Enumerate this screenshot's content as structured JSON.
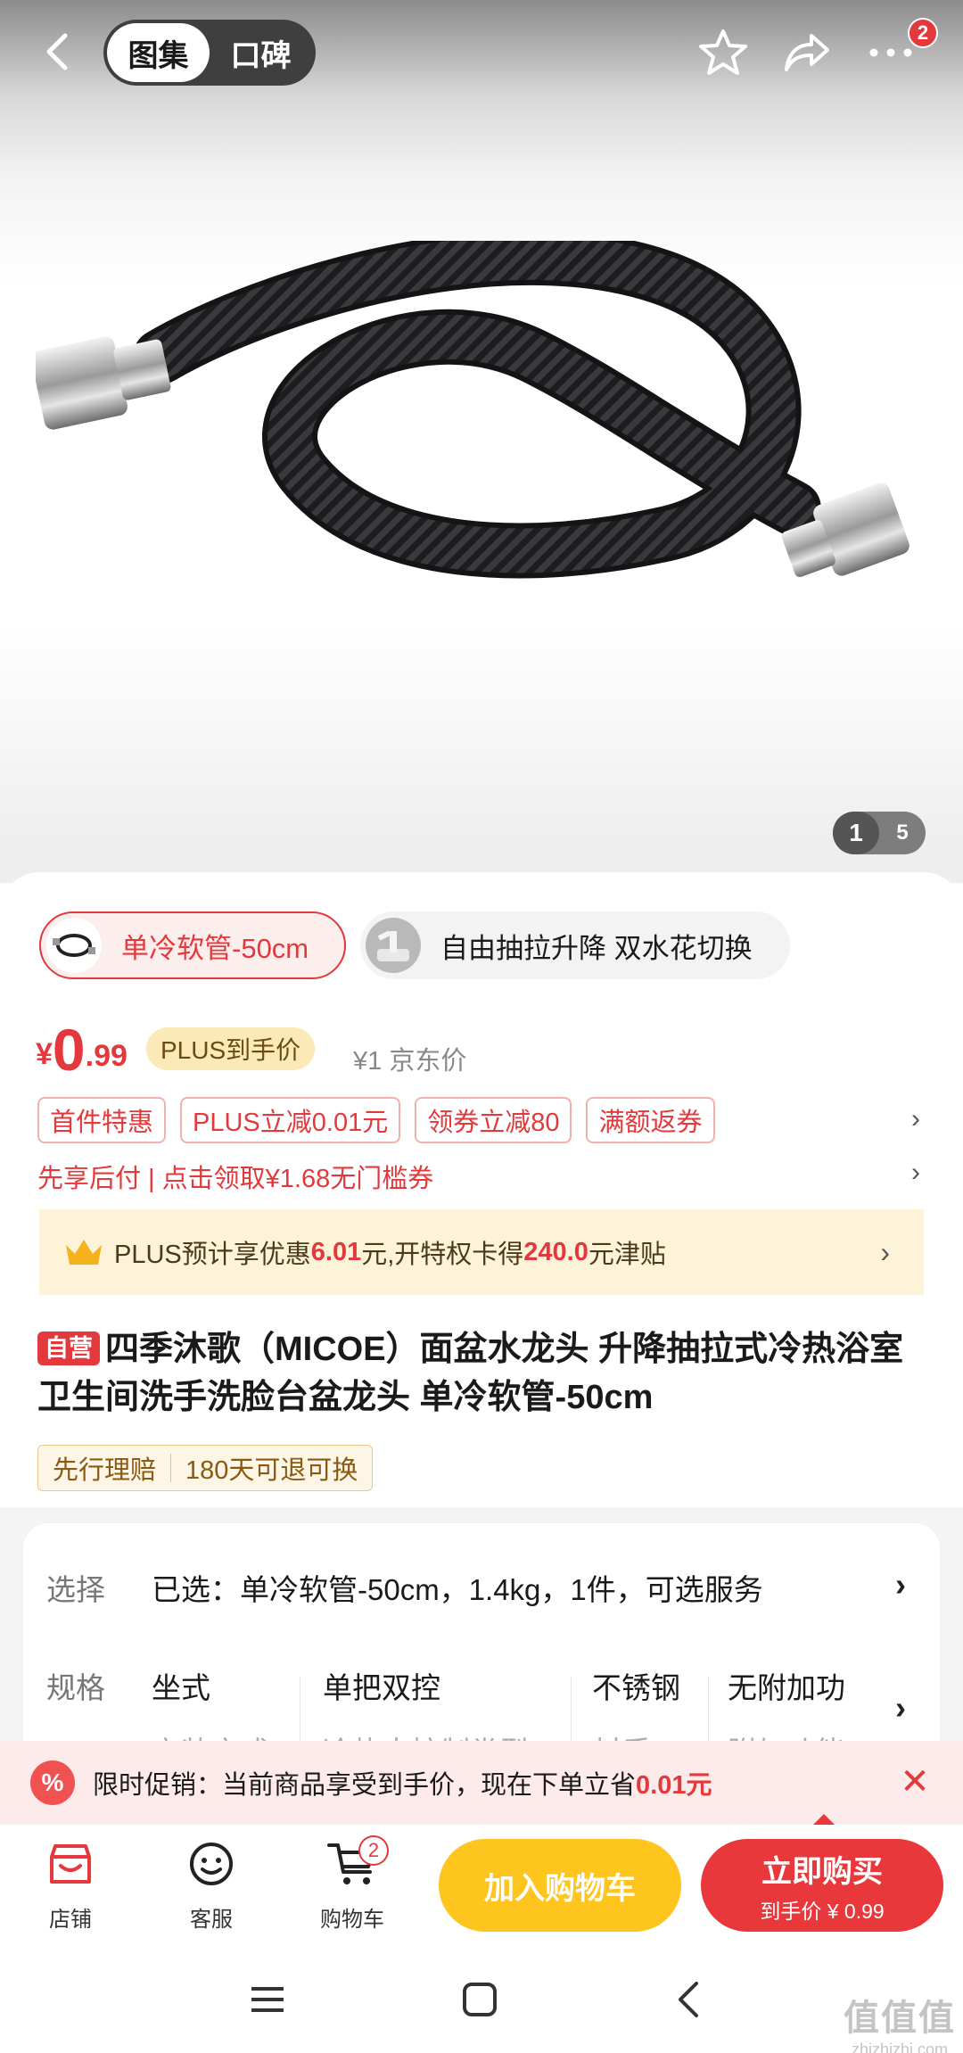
{
  "header": {
    "tabs": [
      {
        "label": "图集",
        "active": true
      },
      {
        "label": "口碑",
        "active": false
      }
    ],
    "more_badge": "2"
  },
  "gallery": {
    "current": "1",
    "total": "5"
  },
  "variants": [
    {
      "label": "单冷软管-50cm",
      "selected": true
    },
    {
      "label": "自由抽拉升降 双水花切换",
      "selected": false
    }
  ],
  "price": {
    "currency": "¥",
    "integer": "0",
    "decimal": ".99",
    "plus_tag": "PLUS到手价",
    "reference": "¥1 京东价"
  },
  "promos": [
    "首件特惠",
    "PLUS立减0.01元",
    "领券立减80",
    "满额返券"
  ],
  "pay_later": "先享后付 | 点击领取¥1.68无门槛券",
  "plus_banner": {
    "prefix": "PLUS预计享优惠",
    "amount": "6.01",
    "middle": "元,开特权卡得",
    "allowance": "240.0",
    "suffix": "元津贴"
  },
  "product": {
    "self_tag": "自营",
    "title": "四季沐歌（MICOE）面盆水龙头 升降抽拉式冷热浴室卫生间洗手洗脸台盆龙头 单冷软管-50cm",
    "services": [
      "先行理赔",
      "180天可退可换"
    ]
  },
  "selection": {
    "label": "选择",
    "value": "已选：单冷软管-50cm，1.4kg，1件，可选服务"
  },
  "specs": {
    "label": "规格",
    "items": [
      {
        "value": "坐式",
        "name": "安装方式"
      },
      {
        "value": "单把双控",
        "name": "冷热水控制类型"
      },
      {
        "value": "不锈钢",
        "name": "材质"
      },
      {
        "value": "无附加功",
        "name": "附加功能"
      }
    ]
  },
  "limit_bar": {
    "icon": "%",
    "text": "限时促销：当前商品享受到手价，现在下单立省",
    "amount": "0.01元"
  },
  "bottom_bar": {
    "store": "店铺",
    "service": "客服",
    "cart": "购物车",
    "cart_badge": "2",
    "add_cart": "加入购物车",
    "buy_now": "立即购买",
    "buy_price": "到手价 ¥ 0.99"
  },
  "watermark": {
    "logo": "值值值",
    "url": "zhizhizhi.com"
  },
  "colors": {
    "accent_red": "#e4393c",
    "cart_yellow": "#ffc51f",
    "plus_gold": "#fbe9b7"
  }
}
